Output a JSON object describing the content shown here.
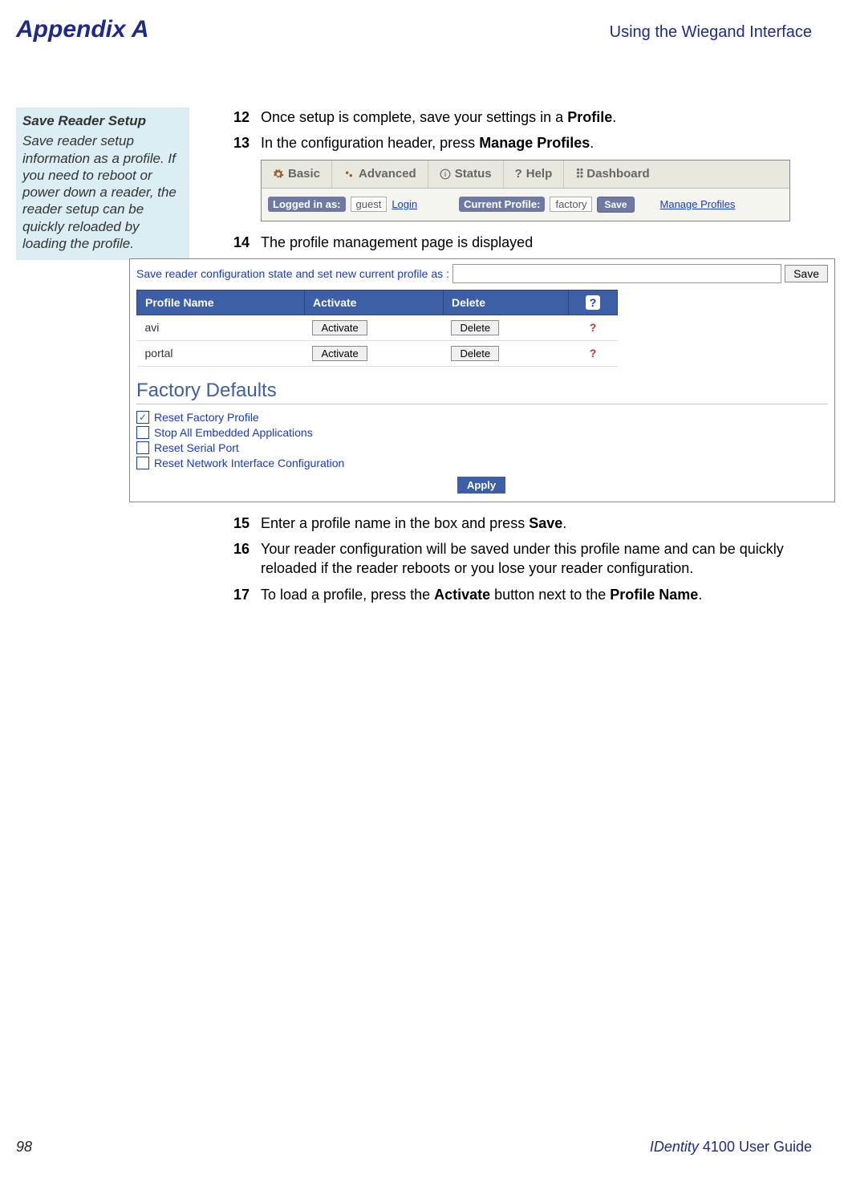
{
  "header": {
    "appendix": "Appendix A",
    "section": "Using the Wiegand Interface"
  },
  "sidebar": {
    "title": "Save Reader Setup",
    "body": "Save reader setup information as a profile. If you need to reboot or power down a reader, the reader setup can be quickly reloaded by loading the profile."
  },
  "steps": {
    "s12": {
      "num": "12",
      "text_a": "Once setup is complete, save your settings in a ",
      "bold": "Profile",
      "text_b": "."
    },
    "s13": {
      "num": "13",
      "text_a": "In the configuration header, press ",
      "bold": "Manage Profiles",
      "text_b": "."
    },
    "s14": {
      "num": "14",
      "text": "The profile management page is displayed"
    },
    "s15": {
      "num": "15",
      "text_a": "Enter a profile name in the box and press ",
      "bold": "Save",
      "text_b": "."
    },
    "s16": {
      "num": "16",
      "text": "Your reader configuration will be saved under this profile name and can be quickly reloaded if the reader reboots or you lose your reader configuration."
    },
    "s17": {
      "num": "17",
      "text_a": "To load a profile, press the ",
      "bold1": "Activate",
      "mid": " button next to the ",
      "bold2": "Profile Name",
      "text_b": "."
    }
  },
  "scr1": {
    "tabs": {
      "basic": "Basic",
      "advanced": "Advanced",
      "status": "Status",
      "help": "Help",
      "dashboard": "Dashboard"
    },
    "logged_label": "Logged in as:",
    "user": "guest",
    "login": "Login",
    "profile_label": "Current Profile:",
    "profile": "factory",
    "save": "Save",
    "manage": "Manage Profiles"
  },
  "scr2": {
    "saveline": "Save reader configuration state and set new current profile as :",
    "savebtn": "Save",
    "headers": {
      "name": "Profile Name",
      "activate": "Activate",
      "delete": "Delete"
    },
    "rows": [
      {
        "name": "avi",
        "activate": "Activate",
        "delete": "Delete"
      },
      {
        "name": "portal",
        "activate": "Activate",
        "delete": "Delete"
      }
    ],
    "fd_title": "Factory Defaults",
    "cb": {
      "reset_profile": "Reset Factory Profile",
      "stop_apps": "Stop All Embedded Applications",
      "reset_serial": "Reset Serial Port",
      "reset_net": "Reset Network Interface Configuration"
    },
    "apply": "Apply"
  },
  "footer": {
    "page": "98",
    "guide_prefix": "IDentity",
    "guide_rest": " 4100 User Guide"
  }
}
